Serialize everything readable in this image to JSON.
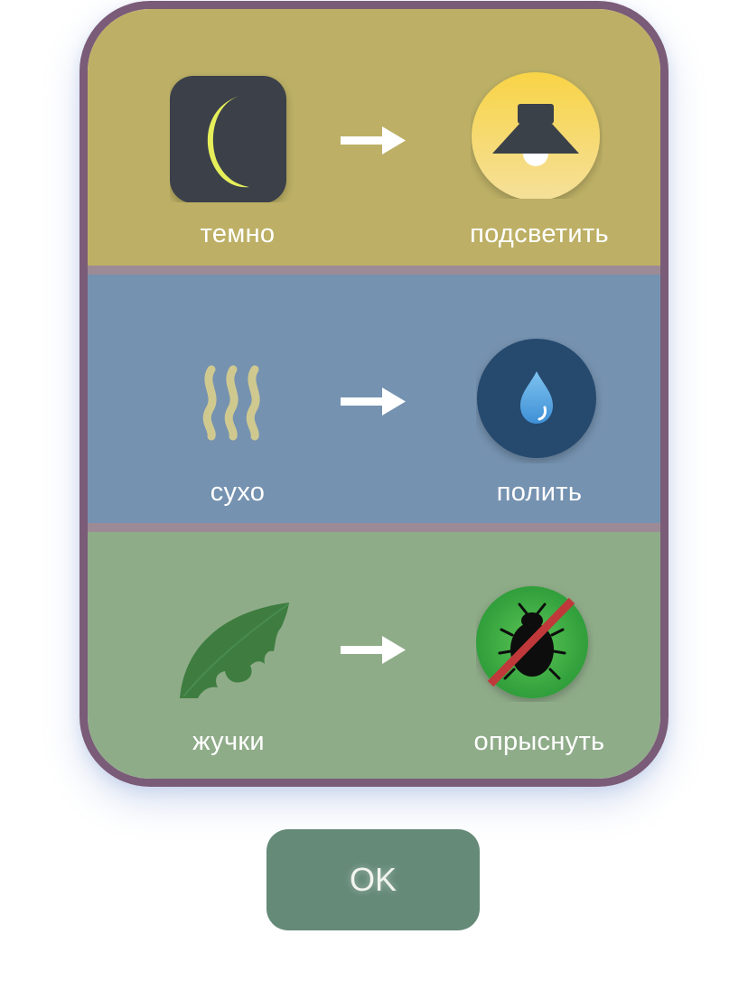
{
  "rules": [
    {
      "condition": "темно",
      "action": "подсветить",
      "condition_icon": "moon-icon",
      "action_icon": "lamp-icon"
    },
    {
      "condition": "сухо",
      "action": "полить",
      "condition_icon": "heat-waves-icon",
      "action_icon": "water-drop-icon"
    },
    {
      "condition": "жучки",
      "action": "опрыснуть",
      "condition_icon": "chewed-leaf-icon",
      "action_icon": "no-bugs-icon"
    }
  ],
  "ok_button": {
    "label": "OK"
  },
  "colors": {
    "dark_section": "#bdb066",
    "dry_section": "#7592b0",
    "bugs_section": "#8fac89",
    "card_border": "#7a5b78",
    "ok_button": "#658a78"
  }
}
